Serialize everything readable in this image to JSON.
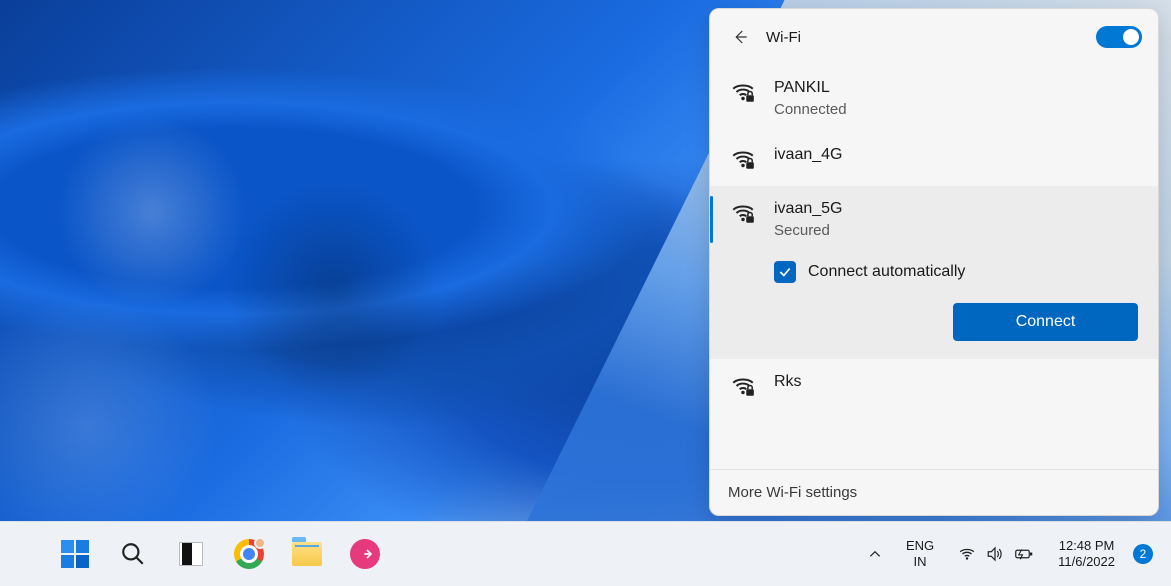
{
  "wifi_panel": {
    "title": "Wi-Fi",
    "toggle_on": true,
    "networks": [
      {
        "name": "PANKIL",
        "status": "Connected",
        "secured": true
      },
      {
        "name": "ivaan_4G",
        "status": "",
        "secured": true
      },
      {
        "name": "ivaan_5G",
        "status": "Secured",
        "secured": true,
        "selected": true
      },
      {
        "name": "Rks",
        "status": "",
        "secured": true
      }
    ],
    "expanded": {
      "auto_connect_label": "Connect automatically",
      "auto_connect_checked": true,
      "connect_button": "Connect"
    },
    "more_settings": "More Wi-Fi settings"
  },
  "taskbar": {
    "language": {
      "line1": "ENG",
      "line2": "IN"
    },
    "clock": {
      "time": "12:48 PM",
      "date": "11/6/2022"
    },
    "notification_count": "2"
  },
  "icons": {
    "back": "back-icon",
    "wifi_secure": "wifi-secure-icon",
    "checkmark": "checkmark-icon",
    "chevron_up": "chevron-up-icon",
    "wifi": "wifi-icon",
    "volume": "volume-icon",
    "battery": "battery-icon",
    "search": "search-icon"
  }
}
